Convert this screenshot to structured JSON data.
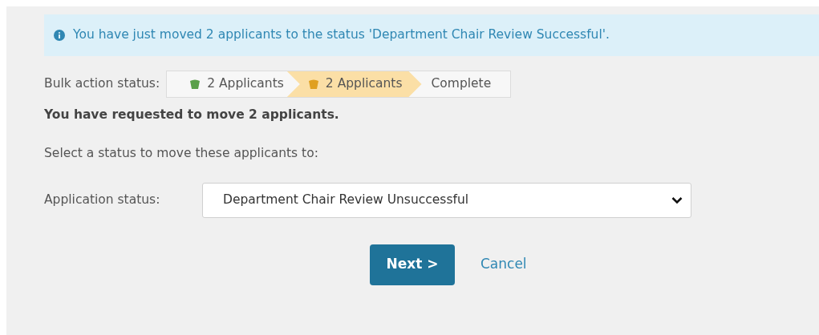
{
  "alert": {
    "text": "You have just moved 2 applicants to the status 'Department Chair Review Successful'."
  },
  "bulk_status": {
    "label": "Bulk action status:",
    "steps": [
      {
        "label": "2 Applicants",
        "kind": "done"
      },
      {
        "label": "2 Applicants",
        "kind": "current"
      },
      {
        "label": "Complete",
        "kind": "pending"
      }
    ]
  },
  "request_text": "You have requested to move 2 applicants.",
  "instruction": "Select a status to move these applicants to:",
  "application_status": {
    "label": "Application status:",
    "value": "Department Chair Review Unsuccessful"
  },
  "buttons": {
    "next": "Next >",
    "cancel": "Cancel"
  }
}
